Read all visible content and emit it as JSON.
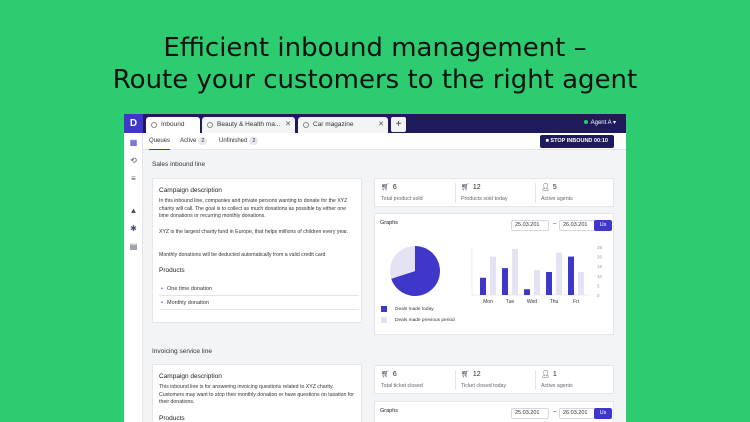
{
  "headline": {
    "line1": "Efficient inbound management –",
    "line2": "Route your customers to the right agent"
  },
  "app": {
    "logo": "D",
    "tabs": [
      {
        "label": "Inbound",
        "icon": "play-icon"
      },
      {
        "label": "Beauty & Health ma...",
        "icon": "circle-icon"
      },
      {
        "label": "Car magazine",
        "icon": "circle-icon"
      }
    ],
    "add_tab": "+",
    "agent": "Agent A",
    "subnav": {
      "queues": "Queues",
      "active": "Active",
      "active_count": "2",
      "unfinished": "Unfinished",
      "unfinished_count": "2",
      "stop_button": "STOP INBOUND 00:10"
    },
    "sales": {
      "section_title": "Sales inbound line",
      "campaign_title": "Campaign description",
      "para1": "In this inbound line, companies and private persons wanting to donate for the XYZ charity will call. The goal is to collect as much donations as possible by either one time donations or recurring monthly donations.",
      "para2": "XYZ is the largest charity fund in Europe, that helps millions of children every year.",
      "para3": "Monthly donations will be deducted automatically from a valid credit card",
      "products_title": "Products",
      "products": [
        "One time donation",
        "Monthly donation"
      ],
      "stats": [
        {
          "value": "6",
          "label": "Total product sold",
          "icon": "cart-icon"
        },
        {
          "value": "12",
          "label": "Products sold today",
          "icon": "cart-icon"
        },
        {
          "value": "5",
          "label": "Active agents",
          "icon": "person-icon"
        }
      ],
      "graphs_title": "Graphs",
      "date_from": "25.03.201",
      "date_to": "26.03.201",
      "dash": "–",
      "us_button": "Us",
      "legend_today": "Deals made today",
      "legend_prev": "Deals made previous period"
    },
    "invoicing": {
      "section_title": "Invoicing service line",
      "campaign_title": "Campaign description",
      "para1": "This inbound line is for answering invoicing questions related to XYZ charity. Customers may want to stop their monthly donation or have questions on taxation for their donations.",
      "products_title": "Products",
      "stats": [
        {
          "value": "6",
          "label": "Total ticket closed",
          "icon": "cart-icon"
        },
        {
          "value": "12",
          "label": "Ticket closed today",
          "icon": "cart-icon"
        },
        {
          "value": "1",
          "label": "Active agents",
          "icon": "person-icon"
        }
      ],
      "graphs_title": "Graphs",
      "date_from": "25.03.201",
      "date_to": "26.03.201",
      "dash": "–",
      "us_button": "Us"
    }
  },
  "colors": {
    "background": "#2ecc71",
    "topbar": "#1f1a5c",
    "accent": "#3f37c9",
    "secondary": "#e3e3f3"
  },
  "chart_data": [
    {
      "type": "pie",
      "values": [
        70,
        30
      ],
      "labels": [
        "Deals made today",
        "Deals made previous period"
      ]
    },
    {
      "type": "bar",
      "categories": [
        "Mon",
        "Tue",
        "Wed",
        "Thu",
        "Fri"
      ],
      "series": [
        {
          "name": "Deals made today",
          "values": [
            9,
            14,
            3,
            12,
            20
          ]
        },
        {
          "name": "Deals made previous period",
          "values": [
            20,
            24,
            13,
            22,
            12
          ]
        }
      ],
      "y_ticks": [
        "25",
        "20",
        "15",
        "10",
        "5",
        "0"
      ],
      "ylim": [
        0,
        25
      ]
    }
  ]
}
